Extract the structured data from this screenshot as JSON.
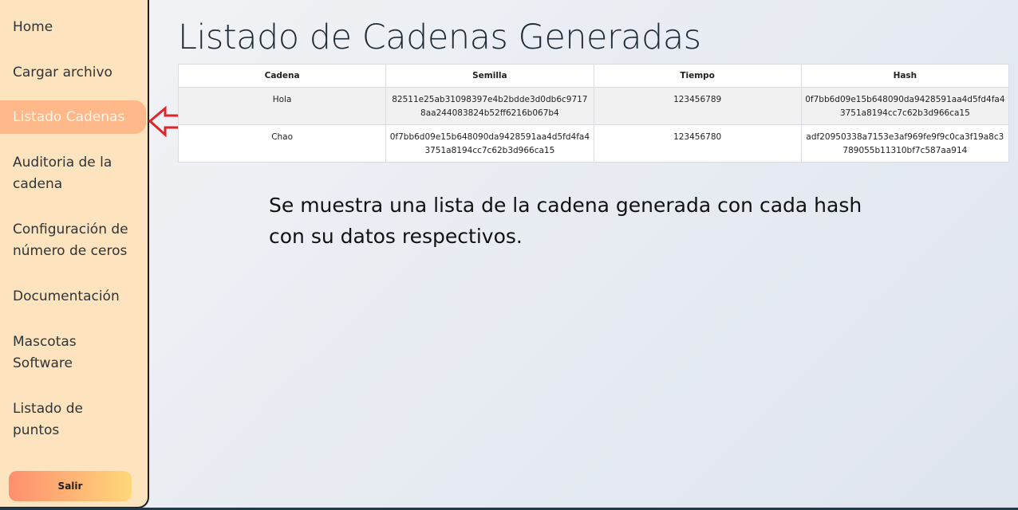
{
  "sidebar": {
    "items": [
      {
        "label": "Home"
      },
      {
        "label": "Cargar archivo"
      },
      {
        "label": "Listado Cadenas"
      },
      {
        "label": "Auditoria de la cadena"
      },
      {
        "label": "Configuración de número de ceros"
      },
      {
        "label": "Documentación"
      },
      {
        "label": "Mascotas Software"
      },
      {
        "label": "Listado de puntos"
      }
    ],
    "active_item": "Listado Cadenas",
    "logout_label": "Salir"
  },
  "main": {
    "title": "Listado de Cadenas Generadas",
    "table": {
      "headers": [
        "Cadena",
        "Semilla",
        "Tiempo",
        "Hash"
      ],
      "rows": [
        [
          "Hola",
          "82511e25ab31098397e4b2bdde3d0db6c97178aa244083824b52ff6216b067b4",
          "123456789",
          "0f7bb6d09e15b648090da9428591aa4d5fd4fa43751a8194cc7c62b3d966ca15"
        ],
        [
          "Chao",
          "0f7bb6d09e15b648090da9428591aa4d5fd4fa43751a8194cc7c62b3d966ca15",
          "123456780",
          "adf20950338a7153e3af969fe9f9c0ca3f19a8c3789055b11310bf7c587aa914"
        ]
      ]
    },
    "note": "Se muestra una lista de la cadena generada con cada hash con su datos respectivos."
  },
  "colors": {
    "sidebar_bg": "#fde3be",
    "active_item_bg": "#ffb88a",
    "annotation_arrow": "#e0242c"
  },
  "icons": {
    "annotation": "left-arrow-icon"
  }
}
